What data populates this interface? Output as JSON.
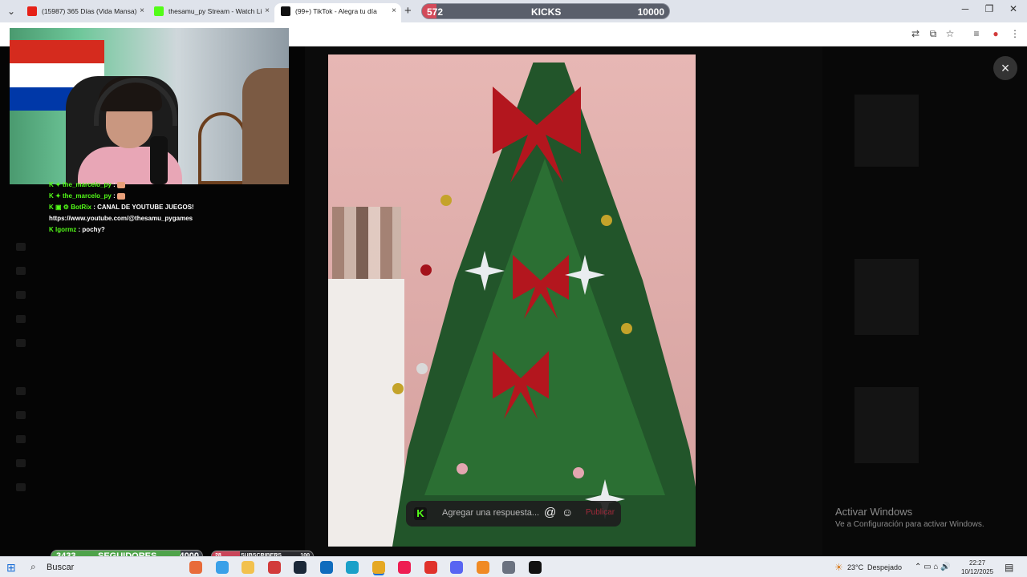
{
  "browser": {
    "tabs": [
      {
        "label": "(15987) 365 Días (Vida Mansa)",
        "favicon": "youtube-icon"
      },
      {
        "label": "thesamu_py Stream - Watch Li",
        "favicon": "kick-icon"
      },
      {
        "label": "(99+) TikTok - Alegra tu día",
        "favicon": "tiktok-icon"
      }
    ],
    "new_tab": "+",
    "close_tab": "×",
    "window_controls": {
      "minimize": "─",
      "restore": "❐",
      "close": "✕"
    },
    "tab_menu": "⌄"
  },
  "overlay_kicks": {
    "current": "572",
    "label": "KICKS",
    "goal": "10000",
    "progress": 0.0572
  },
  "toolbar": {
    "icons": [
      "translate-icon",
      "install-icon",
      "star-icon",
      "media-icon",
      "profile-icon",
      "menu-icon"
    ],
    "glyphs": [
      "⇄",
      "⧉",
      "☆",
      "≡",
      "●",
      "⋮"
    ]
  },
  "chat": [
    {
      "badges": "K ✦",
      "user": "the_marcelo_py",
      "sep": " : ",
      "message": ""
    },
    {
      "badges": "K ✦",
      "user": "the_marcelo_py",
      "sep": " : ",
      "message": ""
    },
    {
      "badges": "K ▣ ⚙",
      "user": "BotRix",
      "sep": " : ",
      "message": "CANAL DE YOUTUBE JUEGOS!"
    },
    {
      "badges": "",
      "user": "",
      "sep": "",
      "message": "https://www.youtube.com/@thesamu_pygames"
    },
    {
      "badges": "K",
      "user": "lgormz",
      "sep": " : ",
      "message": "pochy?"
    }
  ],
  "viewer": {
    "reply_placeholder": "Agregar una respuesta...",
    "mention": "@",
    "emoji": "☺",
    "post": "Publicar",
    "close": "×"
  },
  "windows_watermark": {
    "title": "Activar Windows",
    "subtitle": "Ve a Configuración para activar Windows."
  },
  "overlay_followers": {
    "current": "3433",
    "label": "SEGUIDORES",
    "goal": "4000",
    "progress": 0.858
  },
  "overlay_subs": {
    "current": "28",
    "label": "SUBSCRIBERS",
    "goal": "100",
    "progress": 0.28
  },
  "taskbar": {
    "start": "⊞",
    "search_icon": "⌕",
    "search_label": "Buscar",
    "apps": [
      {
        "name": "widget-icon",
        "color": "#e86b3a"
      },
      {
        "name": "store-icon",
        "color": "#3aa0e8"
      },
      {
        "name": "files-icon",
        "color": "#f2c14e"
      },
      {
        "name": "app-red-icon",
        "color": "#d23b3b"
      },
      {
        "name": "steam-icon",
        "color": "#1b2838"
      },
      {
        "name": "outlook-icon",
        "color": "#0f6cbd"
      },
      {
        "name": "edge-icon",
        "color": "#1aa0c8"
      },
      {
        "name": "chrome-icon",
        "color": "#e5a823"
      },
      {
        "name": "tiktok-icon",
        "color": "#ee1d52"
      },
      {
        "name": "app-red2-icon",
        "color": "#e0322b"
      },
      {
        "name": "discord-icon",
        "color": "#5865f2"
      },
      {
        "name": "app-orange-icon",
        "color": "#f08a24"
      },
      {
        "name": "settings-icon",
        "color": "#6b7280"
      },
      {
        "name": "capcut-icon",
        "color": "#111111"
      }
    ],
    "weather": {
      "temp": "23°C",
      "condition": "Despejado"
    },
    "tray": "⌃  ▭  ⌂  🔊",
    "time": "22:27",
    "date": "10/12/2025",
    "notif": "▤"
  },
  "colors": {
    "kick_green": "#53fc18",
    "accent_red": "#d34b5a"
  }
}
